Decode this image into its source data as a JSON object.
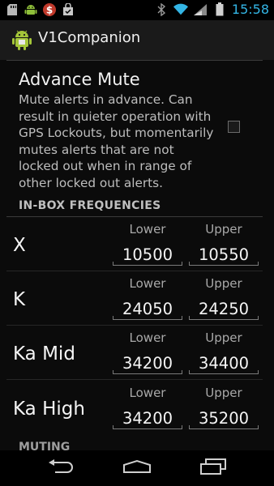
{
  "status_bar": {
    "time": "15:58",
    "left_icons": [
      "sd-card-icon",
      "android-debug-icon",
      "dollar-notification-icon",
      "shopping-bag-icon"
    ],
    "right_icons": [
      "bluetooth-icon",
      "wifi-icon",
      "signal-icon",
      "battery-icon"
    ]
  },
  "action_bar": {
    "app_name": "V1Companion",
    "logo_icon": "android-app-icon"
  },
  "advance_mute": {
    "title": "Advance Mute",
    "summary": "Mute alerts in advance. Can result in quieter operation with GPS Lockouts, but momentarily mutes alerts that are not locked out when in range of other locked out alerts.",
    "checked": false
  },
  "in_box": {
    "header": "IN-BOX FREQUENCIES",
    "lower_label": "Lower",
    "upper_label": "Upper",
    "bands": [
      {
        "name": "X",
        "lower": "10500",
        "upper": "10550"
      },
      {
        "name": "K",
        "lower": "24050",
        "upper": "24250"
      },
      {
        "name": "Ka Mid",
        "lower": "34200",
        "upper": "34400"
      },
      {
        "name": "Ka High",
        "lower": "34200",
        "upper": "35200"
      }
    ]
  },
  "next_section": {
    "header": "MUTING"
  },
  "nav": {
    "back_icon": "back-icon",
    "home_icon": "home-icon",
    "recents_icon": "recents-icon"
  }
}
